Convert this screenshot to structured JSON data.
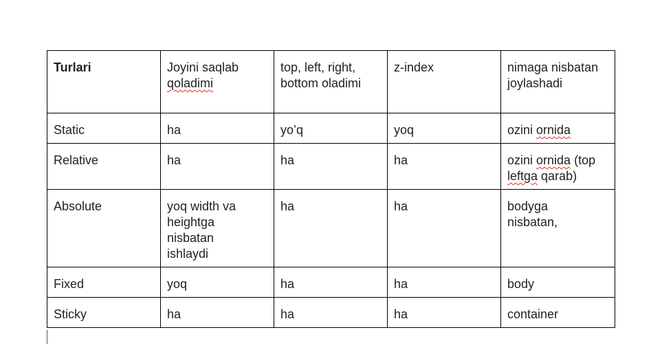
{
  "table": {
    "columns": [
      "Turlari",
      "Joyini saqlab qoladimi",
      "top, left, right, bottom oladimi",
      "z-index",
      "nimaga nisbatan joylashadi"
    ],
    "rows": [
      {
        "turlari": "Static",
        "joyini": "ha",
        "offsets": "yo’q",
        "zindex": "yoq",
        "nisbatan": "ozini ornida"
      },
      {
        "turlari": "Relative",
        "joyini": "ha",
        "offsets": "ha",
        "zindex": "ha",
        "nisbatan": "ozini ornida (top leftga qarab)"
      },
      {
        "turlari": "Absolute",
        "joyini": "yoq width va heightga nisbatan ishlaydi",
        "offsets": "ha",
        "zindex": "ha",
        "nisbatan": "bodyga nisbatan,"
      },
      {
        "turlari": "Fixed",
        "joyini": "yoq",
        "offsets": "ha",
        "zindex": "ha",
        "nisbatan": "body"
      },
      {
        "turlari": "Sticky",
        "joyini": "ha",
        "offsets": "ha",
        "zindex": "ha",
        "nisbatan": "container"
      }
    ]
  },
  "spellcheck_marked_words": [
    "qoladimi",
    "ornida",
    "leftga"
  ],
  "colors": {
    "text": "#222222",
    "border": "#000000",
    "spellcheck_underline": "#d93025",
    "background": "#ffffff"
  }
}
